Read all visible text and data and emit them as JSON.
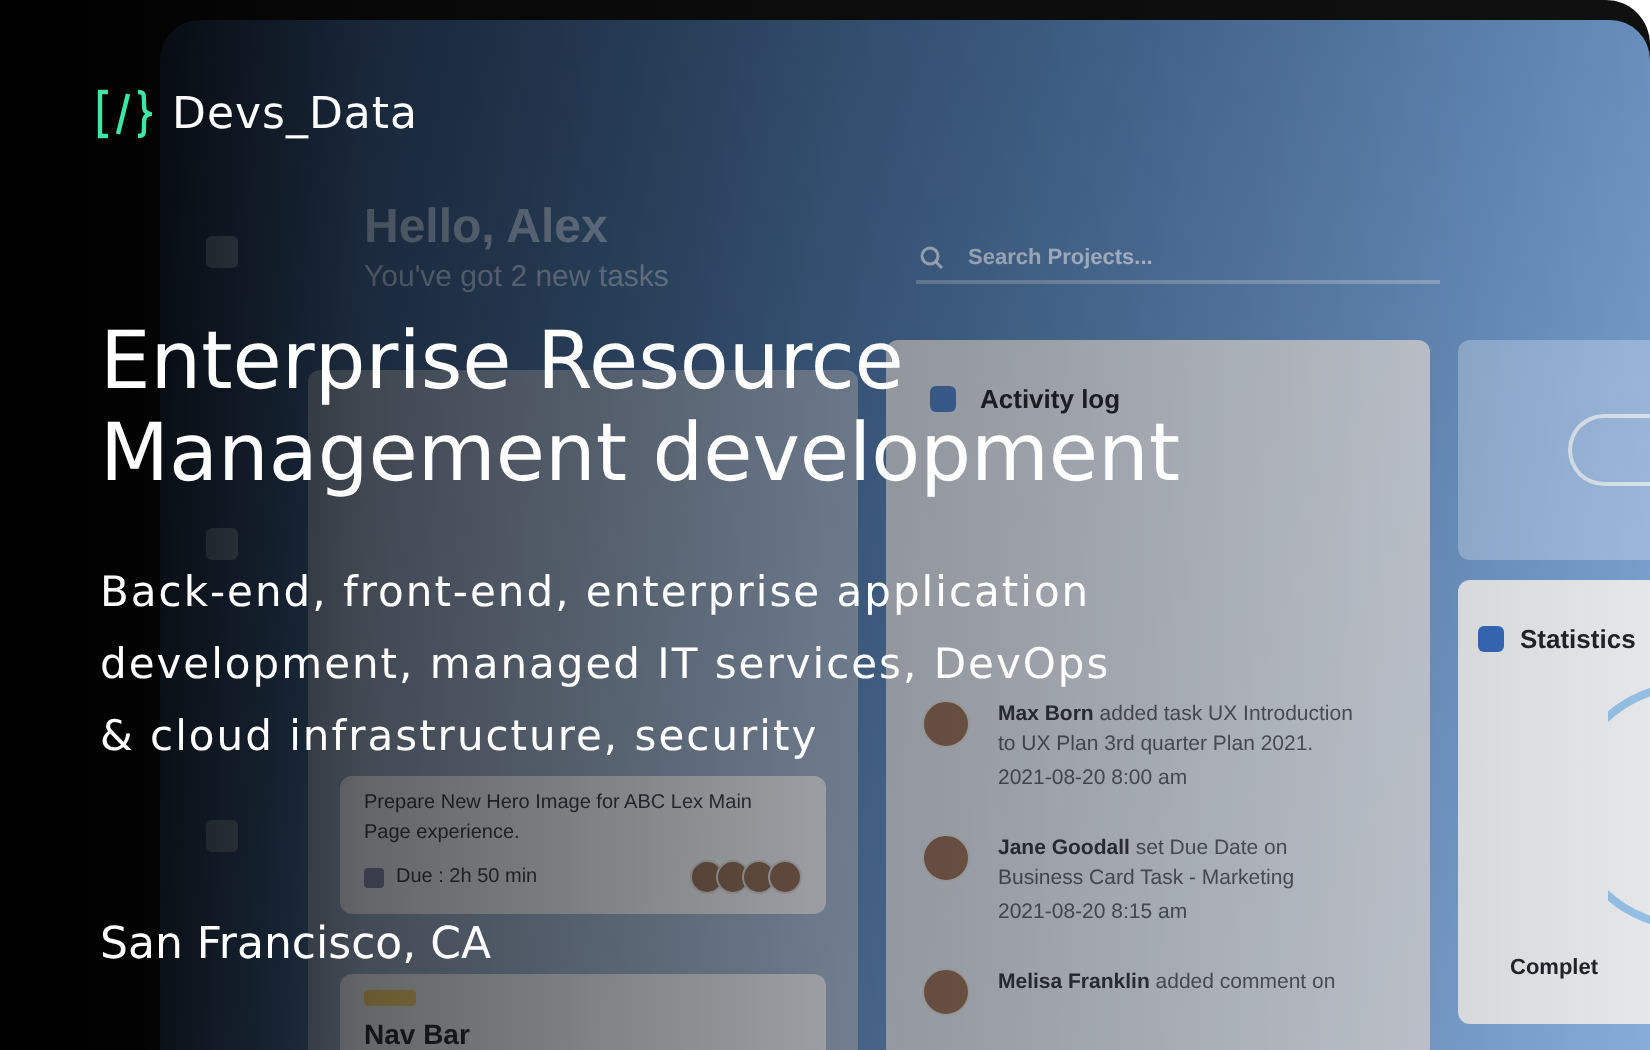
{
  "brand": {
    "name": "Devs_Data"
  },
  "headline_lines": [
    "Enterprise Resource",
    "Management development"
  ],
  "subtitle_lines": [
    "Back-end, front-end, enterprise application",
    "development, managed IT services, DevOps",
    "& cloud infrastructure, security"
  ],
  "location": "San Francisco, CA",
  "app_preview": {
    "greeting": "Hello, Alex",
    "greeting_sub": "You've got 2 new tasks",
    "search": {
      "placeholder": "Search Projects..."
    },
    "tasks": {
      "items": [
        {
          "description": "Prepare New Hero Image for ABC Lex Main Page experience.",
          "due": "Due : 2h 50 min"
        },
        {
          "title": "Nav Bar",
          "tag": true
        }
      ]
    },
    "activity": {
      "title": "Activity log",
      "entries": [
        {
          "name": "Max Born",
          "text": "added task UX Introduction to UX Plan 3rd quarter Plan 2021.",
          "time": "2021-08-20 8:00 am"
        },
        {
          "name": "Jane Goodall",
          "text": "set Due Date on Business Card Task - Marketing",
          "time": "2021-08-20 8:15 am"
        },
        {
          "name": "Melisa Franklin",
          "text": "added comment on"
        }
      ]
    },
    "statistics": {
      "title": "Statistics",
      "legend": "Complet"
    }
  }
}
